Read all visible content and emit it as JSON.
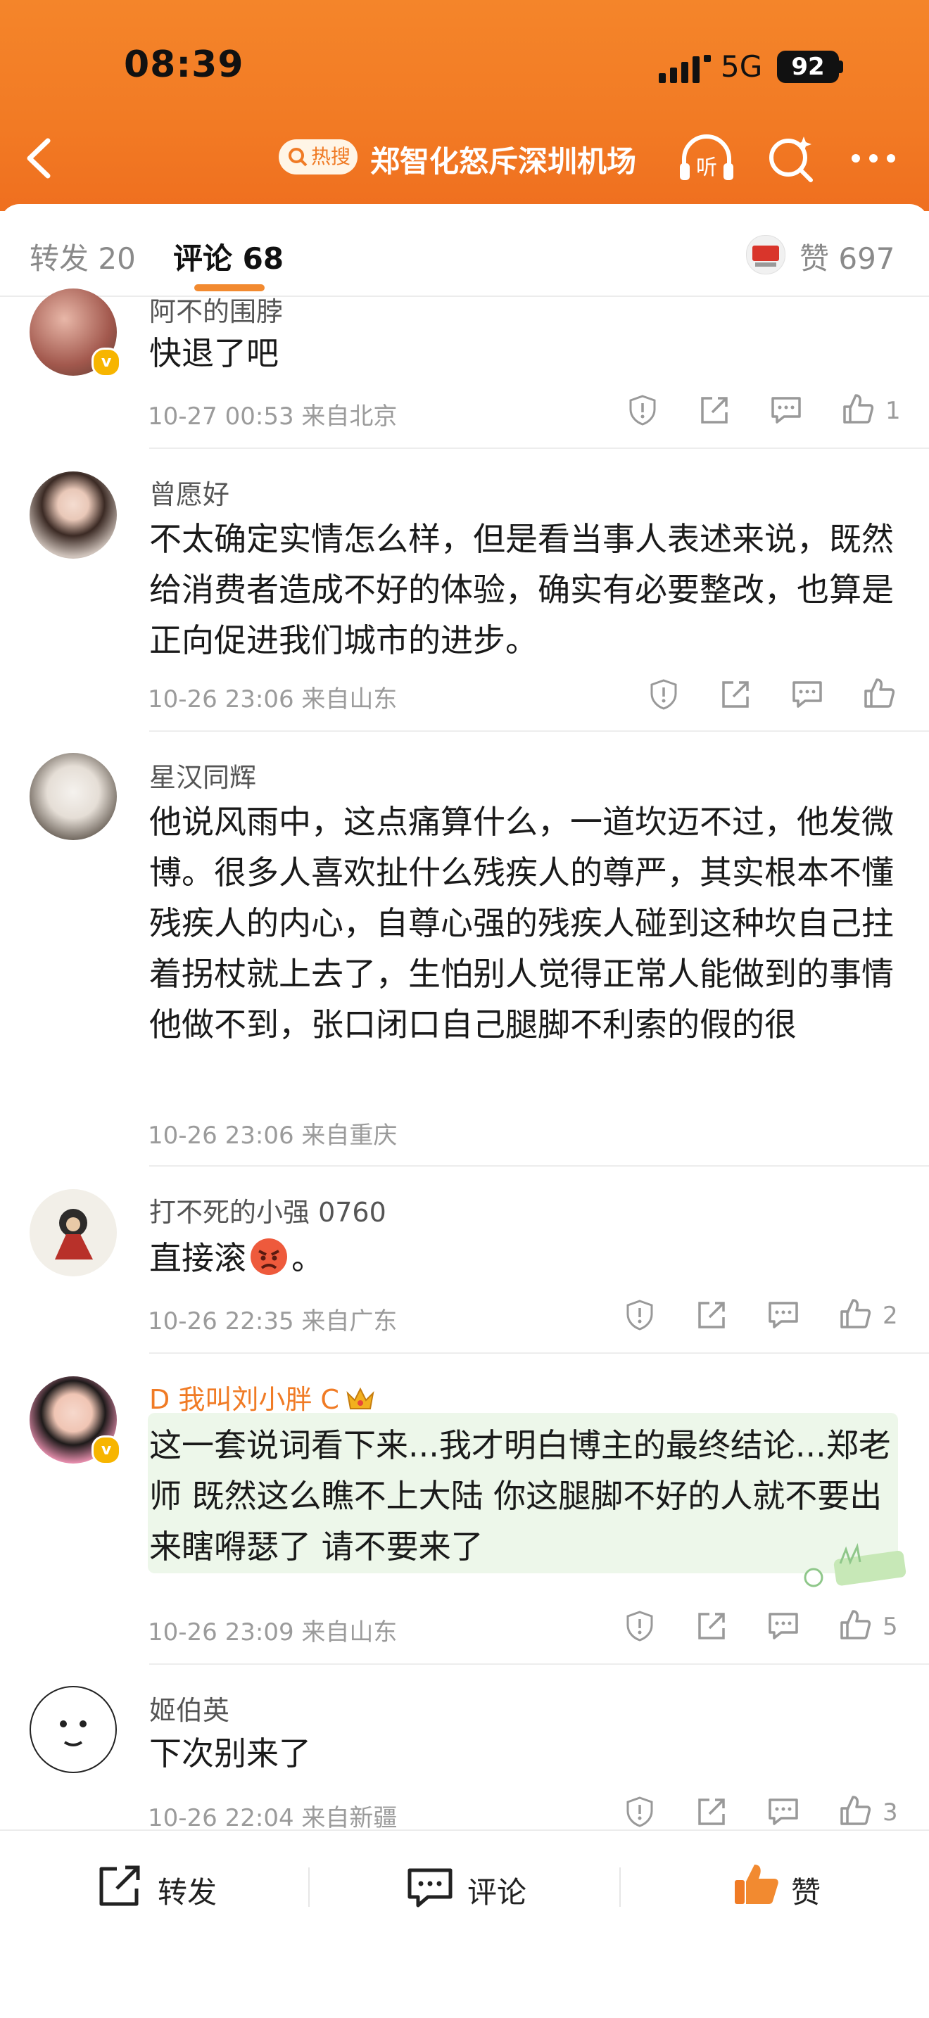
{
  "status_bar": {
    "time": "08:39",
    "network": "5G",
    "battery": "92"
  },
  "header": {
    "hot_badge": "热搜",
    "title": "郑智化怒斥深圳机场",
    "listen_label": "听"
  },
  "tabs": {
    "repost": "转发 20",
    "comment": "评论 68",
    "likes": "赞 697"
  },
  "comments": [
    {
      "user": "阿不的围脖",
      "text": "快退了吧",
      "time": "10-27 00:53",
      "location": "来自北京",
      "likes": "1"
    },
    {
      "user": "曾愿好",
      "text": "不太确定实情怎么样，但是看当事人表述来说，既然给消费者造成不好的体验，确实有必要整改，也算是正向促进我们城市的进步。",
      "time": "10-26 23:06",
      "location": "来自山东",
      "likes": ""
    },
    {
      "user": "星汉同辉",
      "text": "他说风雨中，这点痛算什么，一道坎迈不过，他发微博。很多人喜欢扯什么残疾人的尊严，其实根本不懂残疾人的内心，自尊心强的残疾人碰到这种坎自己拄着拐杖就上去了，生怕别人觉得正常人能做到的事情他做不到，张口闭口自己腿脚不利索的假的很",
      "time": "10-26 23:06",
      "location": "来自重庆",
      "likes": ""
    },
    {
      "user": "打不死的小强 0760",
      "text": "直接滚",
      "text_suffix": "。",
      "time": "10-26 22:35",
      "location": "来自广东",
      "likes": "2"
    },
    {
      "user": "D 我叫刘小胖 C",
      "text": "这一套说词看下来...我才明白博主的最终结论...郑老师 既然这么瞧不上大陆 你这腿脚不好的人就不要出来瞎嘚瑟了 请不要来了",
      "time": "10-26 23:09",
      "location": "来自山东",
      "likes": "5",
      "name_color": "#f07b25"
    },
    {
      "user": "姬伯英",
      "text": "下次别来了",
      "time": "10-26 22:04",
      "location": "来自新疆",
      "likes": "3"
    }
  ],
  "bottom_bar": {
    "repost": "转发",
    "comment": "评论",
    "like": "赞"
  },
  "colors": {
    "header_orange": "#f27a24",
    "accent": "#f28a30",
    "meta_gray": "#9b9b9b"
  }
}
